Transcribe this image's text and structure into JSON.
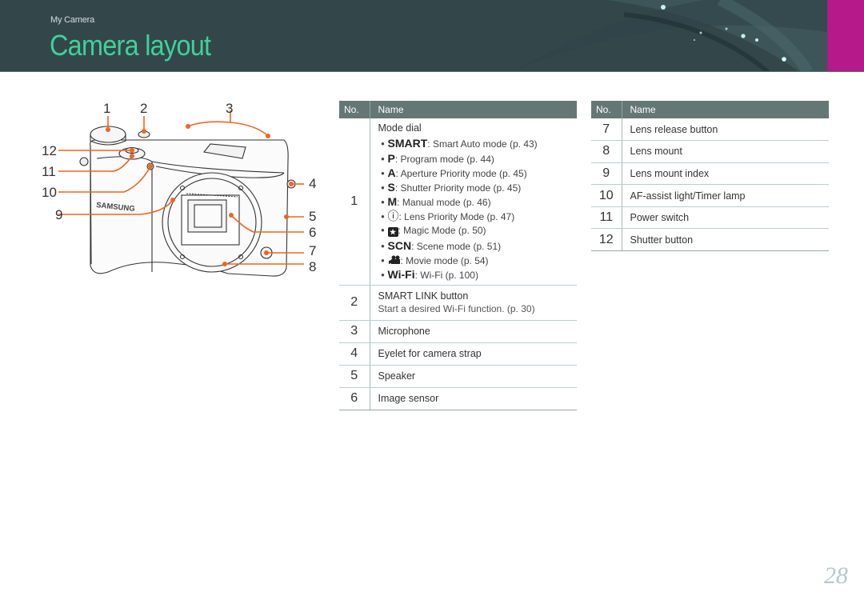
{
  "header": {
    "section": "My Camera",
    "title": "Camera layout"
  },
  "colors": {
    "banner": "#33474b",
    "title_accent": "#3fd19a",
    "side_tab": "#b5198a",
    "table_header": "#647775",
    "callout_line": "#f26522"
  },
  "diagram": {
    "brand_text": "SAMSUNG",
    "callouts": [
      "1",
      "2",
      "3",
      "4",
      "5",
      "6",
      "7",
      "8",
      "9",
      "10",
      "11",
      "12"
    ]
  },
  "tables": {
    "headers": {
      "no": "No.",
      "name": "Name"
    },
    "left": {
      "item1": {
        "no": "1",
        "title": "Mode dial",
        "modes": [
          {
            "icon": "smart-auto-icon",
            "glyph": "SMART",
            "text": ": Smart Auto mode (p. 43)"
          },
          {
            "icon": "program-icon",
            "glyph": "P",
            "text": ": Program mode (p. 44)"
          },
          {
            "icon": "aperture-icon",
            "glyph": "A",
            "text": ": Aperture Priority mode (p. 45)"
          },
          {
            "icon": "shutter-icon",
            "glyph": "S",
            "text": ": Shutter Priority mode (p. 45)"
          },
          {
            "icon": "manual-icon",
            "glyph": "M",
            "text": ": Manual mode (p. 46)"
          },
          {
            "icon": "lens-priority-icon",
            "glyph": "ⓘ",
            "text": ": Lens Priority Mode (p. 47)"
          },
          {
            "icon": "magic-icon",
            "glyph": "★",
            "text": ": Magic Mode (p. 50)"
          },
          {
            "icon": "scene-icon",
            "glyph": "SCN",
            "text": ": Scene mode (p. 51)"
          },
          {
            "icon": "movie-icon",
            "glyph": "🎥",
            "text": ": Movie mode (p. 54)"
          },
          {
            "icon": "wifi-icon",
            "glyph": "Wi-Fi",
            "text": ": Wi-Fi (p. 100)"
          }
        ]
      },
      "item2": {
        "no": "2",
        "title": "SMART LINK button",
        "sub": "Start a desired Wi-Fi function. (p. 30)"
      },
      "rows": [
        {
          "no": "3",
          "name": "Microphone"
        },
        {
          "no": "4",
          "name": "Eyelet for camera strap"
        },
        {
          "no": "5",
          "name": "Speaker"
        },
        {
          "no": "6",
          "name": "Image sensor"
        }
      ]
    },
    "right": {
      "rows": [
        {
          "no": "7",
          "name": "Lens release button"
        },
        {
          "no": "8",
          "name": "Lens mount"
        },
        {
          "no": "9",
          "name": "Lens mount index"
        },
        {
          "no": "10",
          "name": "AF-assist light/Timer lamp"
        },
        {
          "no": "11",
          "name": "Power switch"
        },
        {
          "no": "12",
          "name": "Shutter button"
        }
      ]
    }
  },
  "page_number": "28"
}
